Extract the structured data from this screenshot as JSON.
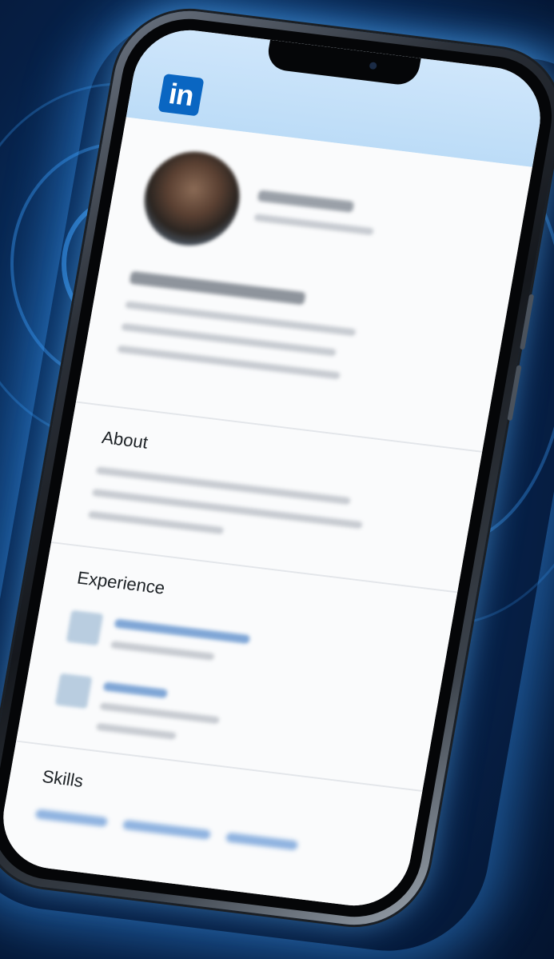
{
  "app": {
    "logo_text": "in",
    "brand_color": "#0a66c2"
  },
  "profile": {
    "name": "",
    "headline": "",
    "subheading": ""
  },
  "sections": {
    "about_title": "About",
    "experience_title": "Experience",
    "skills_title": "Skills"
  },
  "icons": {
    "logo": "linkedin-logo-icon",
    "avatar": "avatar"
  }
}
